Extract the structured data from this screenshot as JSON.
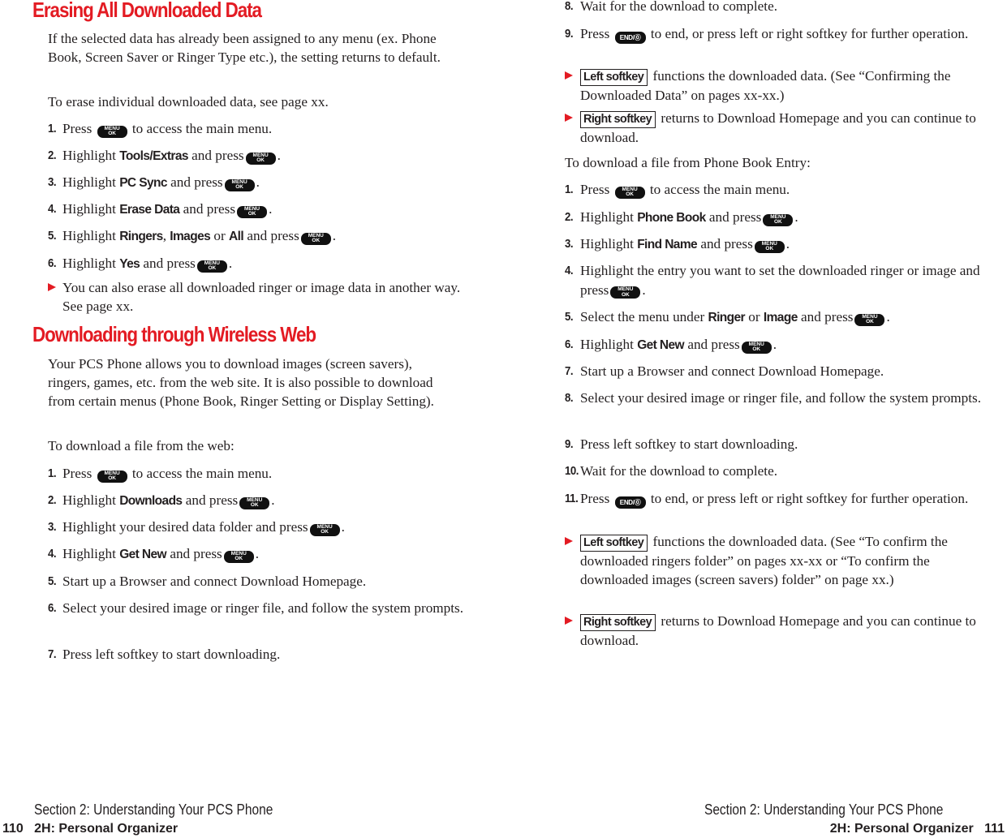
{
  "keys": {
    "menu_top": "MENU",
    "menu_bottom": "OK",
    "end": "END/⓪"
  },
  "left_page": {
    "heading1": "Erasing All Downloaded Data",
    "intro1": "If the selected data has already been assigned to any menu (ex. Phone Book, Screen Saver or Ringer Type etc.), the setting returns to default.",
    "intro2": "To erase individual downloaded data, see page xx.",
    "erase_steps": [
      {
        "num": "1.",
        "pre": "Press",
        "post": "to access the main menu."
      },
      {
        "num": "2.",
        "pre": "Highlight",
        "kw": "Tools/Extras",
        "post": "and press"
      },
      {
        "num": "3.",
        "pre": "Highlight",
        "kw": "PC Sync",
        "post": "and press"
      },
      {
        "num": "4.",
        "pre": "Highlight",
        "kw": "Erase Data",
        "post": "and press"
      },
      {
        "num": "5.",
        "pre": "Highlight",
        "kw": "Ringers",
        "sep1": ",",
        "kw2": "Images",
        "mid": "or",
        "kw3": "All",
        "post": "and press"
      },
      {
        "num": "6.",
        "pre": "Highlight",
        "kw": "Yes",
        "post": "and press"
      }
    ],
    "erase_note": "You can also erase all downloaded ringer or image data in another way. See page xx.",
    "heading2": "Downloading through Wireless Web",
    "intro3": "Your PCS Phone allows you to download images (screen savers), ringers, games, etc. from the web site. It is also possible to download from certain menus (Phone Book, Ringer Setting or Display Setting).",
    "intro4": "To download a file from the web:",
    "web_steps": [
      {
        "num": "1.",
        "pre": "Press",
        "post": "to access the main menu."
      },
      {
        "num": "2.",
        "pre": "Highlight",
        "kw": "Downloads",
        "post": "and press"
      },
      {
        "num": "3.",
        "pre": "Highlight your desired data folder and press"
      },
      {
        "num": "4.",
        "pre": "Highlight",
        "kw": "Get New",
        "post": "and press"
      },
      {
        "num": "5.",
        "text": "Start up a Browser and connect Download Homepage."
      },
      {
        "num": "6.",
        "text": "Select your desired image or ringer file, and follow the system prompts."
      },
      {
        "num": "7.",
        "text": "Press left softkey to start downloading."
      }
    ],
    "footer_section": "Section 2: Understanding Your PCS Phone",
    "page_number": "110",
    "footer_chapter": "2H: Personal Organizer"
  },
  "right_page": {
    "web_steps_cont": [
      {
        "num": "8.",
        "text": "Wait for the download to complete."
      },
      {
        "num": "9.",
        "pre": "Press",
        "post": "to end, or press left or right softkey for further operation."
      }
    ],
    "web_notes": [
      {
        "softkey": "Left softkey",
        "text": "functions the downloaded data. (See “Confirming the Downloaded Data” on pages xx-xx.)"
      },
      {
        "softkey": "Right softkey",
        "text": "returns to Download Homepage and you can continue to download."
      }
    ],
    "intro5": "To download a file from Phone Book Entry:",
    "pb_steps": [
      {
        "num": "1.",
        "pre": "Press",
        "post": "to access the main menu."
      },
      {
        "num": "2.",
        "pre": "Highlight",
        "kw": "Phone Book",
        "post": "and press"
      },
      {
        "num": "3.",
        "pre": "Highlight",
        "kw": "Find Name",
        "post": "and press"
      },
      {
        "num": "4.",
        "pre": "Highlight the entry you want to set the downloaded ringer or image and press"
      },
      {
        "num": "5.",
        "pre": "Select the menu under",
        "kw": "Ringer",
        "mid": "or",
        "kw2": "Image",
        "post": "and press"
      },
      {
        "num": "6.",
        "pre": "Highlight",
        "kw": "Get New",
        "post": "and press"
      },
      {
        "num": "7.",
        "text": "Start up a Browser and connect Download Homepage."
      },
      {
        "num": "8.",
        "text": "Select your desired image or ringer file, and follow the system prompts."
      },
      {
        "num": "9.",
        "text": "Press left softkey to start downloading."
      },
      {
        "num": "10.",
        "text": "Wait for the download to complete."
      },
      {
        "num": "11.",
        "pre": "Press",
        "post": "to end, or press left or right softkey for further operation."
      }
    ],
    "pb_notes": [
      {
        "softkey": "Left softkey",
        "text": "functions the downloaded data. (See “To confirm the downloaded ringers folder” on pages xx-xx or “To confirm the downloaded images (screen savers) folder” on page xx.)"
      },
      {
        "softkey": "Right softkey",
        "text": "returns to Download Homepage and you can continue to download."
      }
    ],
    "footer_section": "Section 2: Understanding Your PCS Phone",
    "page_number": "111",
    "footer_chapter": "2H: Personal Organizer"
  }
}
